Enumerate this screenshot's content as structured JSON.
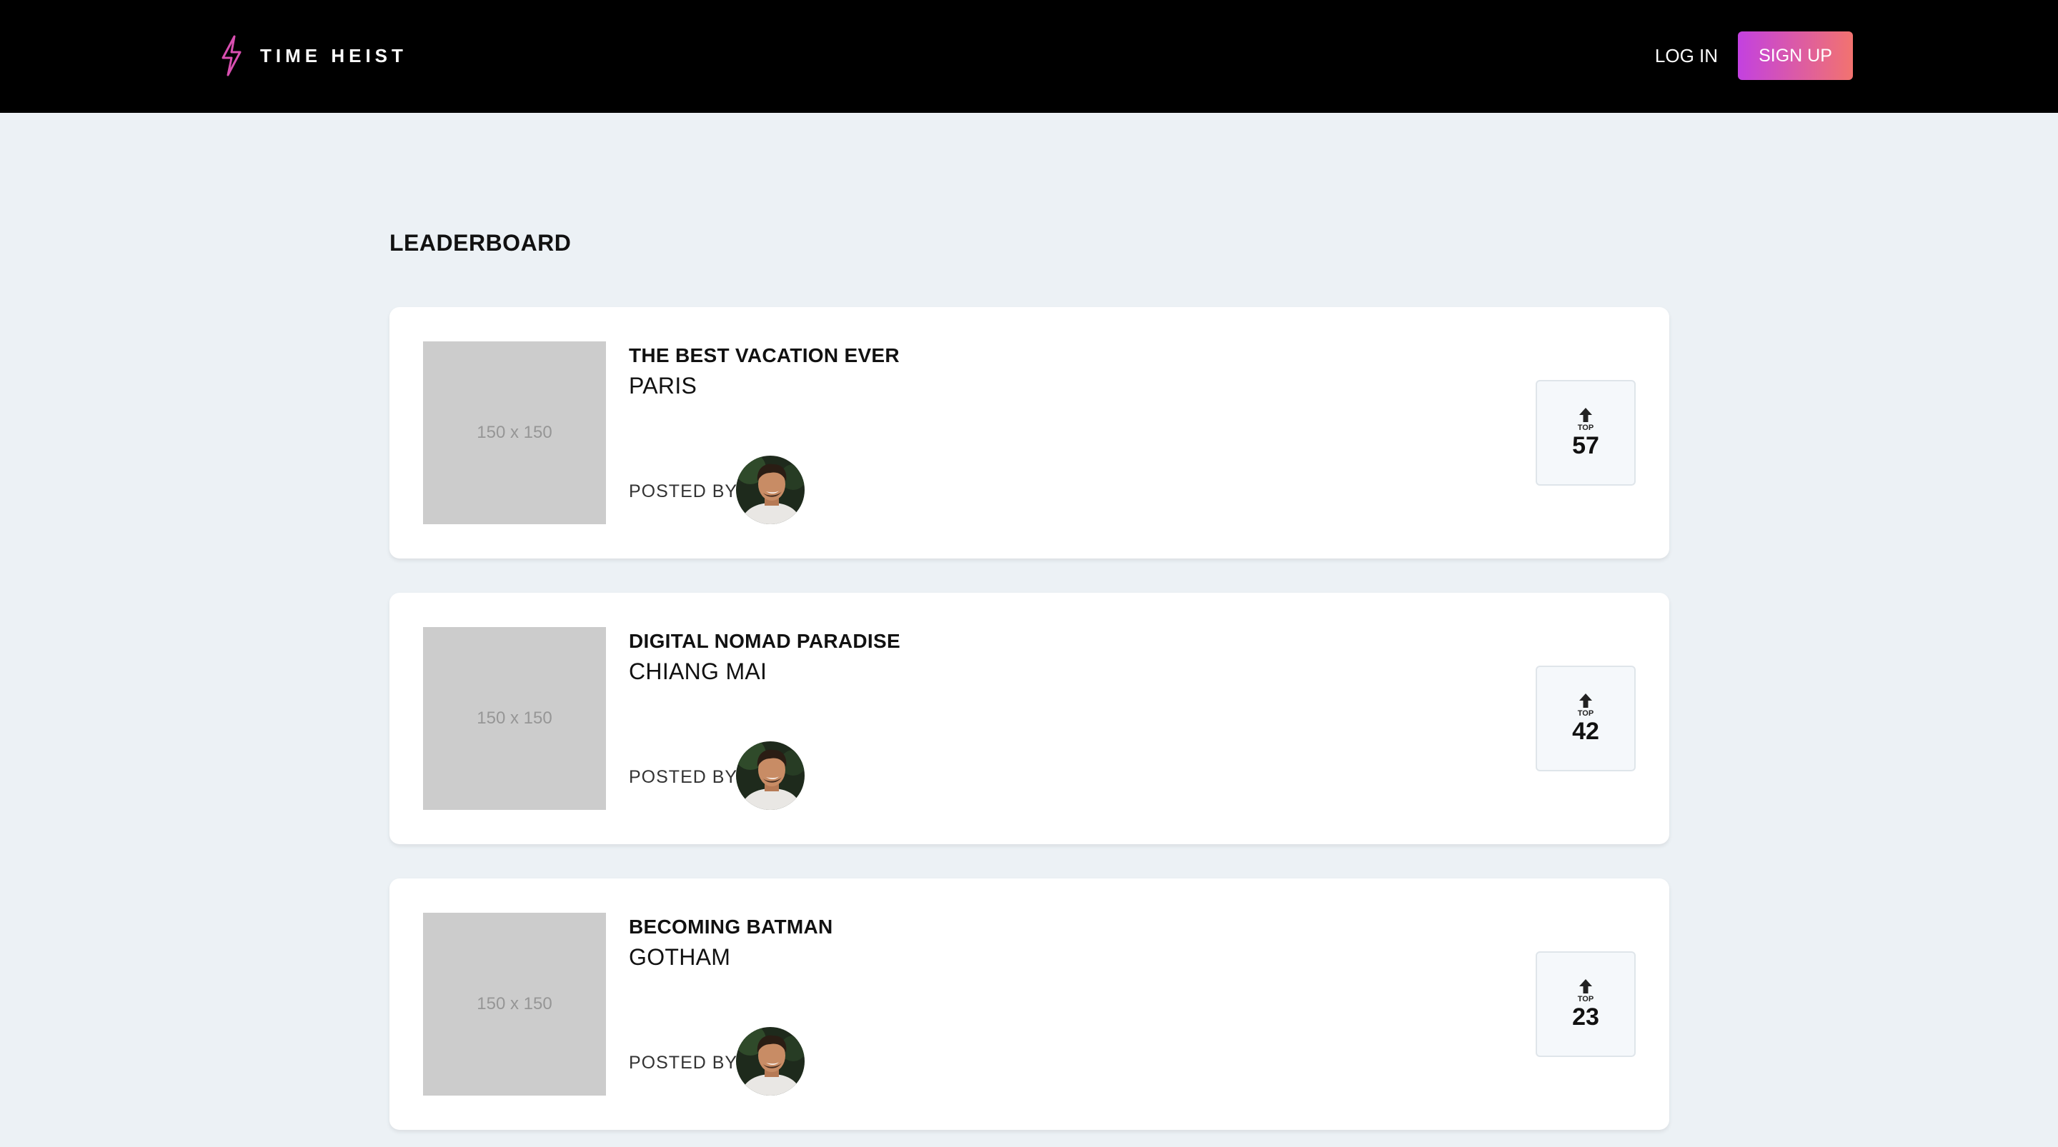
{
  "colors": {
    "header_bg": "#000000",
    "page_bg": "#ecf1f5",
    "signup_gradient": [
      "#c341e0",
      "#f2736f"
    ],
    "logo_bolt": "#d84fb0"
  },
  "header": {
    "brand": "TIME HEIST",
    "login_label": "LOG IN",
    "signup_label": "SIGN UP"
  },
  "main": {
    "title": "LEADERBOARD",
    "entries": [
      {
        "thumbnail_text": "150 x 150",
        "title": "THE BEST VACATION EVER",
        "place": "PARIS",
        "posted_by_label": "POSTED BY",
        "vote_icon": "up-arrow-icon",
        "vote_label": "TOP",
        "votes": "57"
      },
      {
        "thumbnail_text": "150 x 150",
        "title": "DIGITAL NOMAD PARADISE",
        "place": "CHIANG MAI",
        "posted_by_label": "POSTED BY",
        "vote_icon": "up-arrow-icon",
        "vote_label": "TOP",
        "votes": "42"
      },
      {
        "thumbnail_text": "150 x 150",
        "title": "BECOMING BATMAN",
        "place": "GOTHAM",
        "posted_by_label": "POSTED BY",
        "vote_icon": "up-arrow-icon",
        "vote_label": "TOP",
        "votes": "23"
      }
    ]
  }
}
